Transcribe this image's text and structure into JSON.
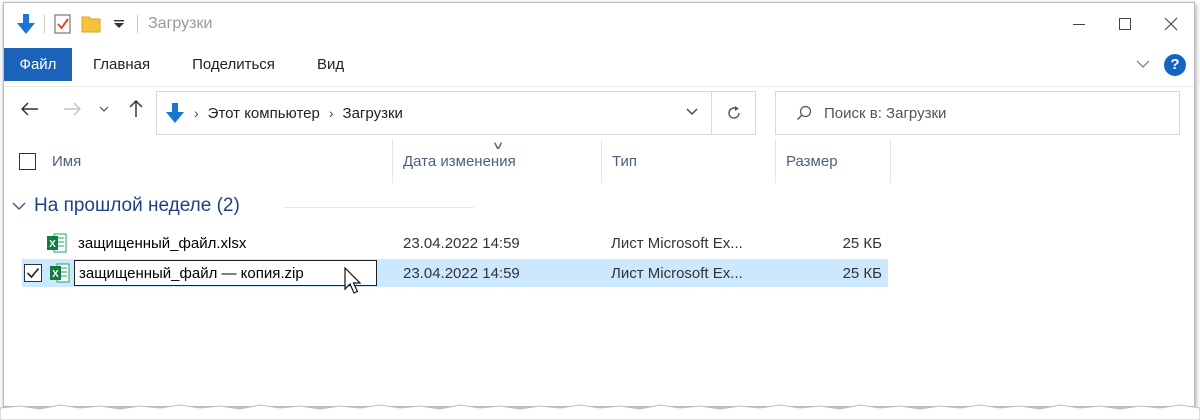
{
  "window": {
    "title": "Загрузки",
    "accent_color": "#1a63b9"
  },
  "quick_access": {
    "icons": [
      "download-arrow-icon",
      "properties-icon",
      "new-folder-icon",
      "customize-dropdown-icon"
    ]
  },
  "ribbon": {
    "tabs": [
      "Файл",
      "Главная",
      "Поделиться",
      "Вид"
    ]
  },
  "address_bar": {
    "breadcrumbs": [
      "Этот компьютер",
      "Загрузки"
    ]
  },
  "search": {
    "placeholder": "Поиск в: Загрузки"
  },
  "columns": {
    "name": "Имя",
    "date": "Дата изменения",
    "type": "Тип",
    "size": "Размер"
  },
  "group": {
    "label": "На прошлой неделе (2)"
  },
  "files": [
    {
      "name": "защищенный_файл.xlsx",
      "date": "23.04.2022 14:59",
      "type": "Лист Microsoft Ex...",
      "size": "25 КБ",
      "selected": false
    },
    {
      "name": "защищенный_файл — копия.zip",
      "date": "23.04.2022 14:59",
      "type": "Лист Microsoft Ex...",
      "size": "25 КБ",
      "selected": true
    }
  ]
}
